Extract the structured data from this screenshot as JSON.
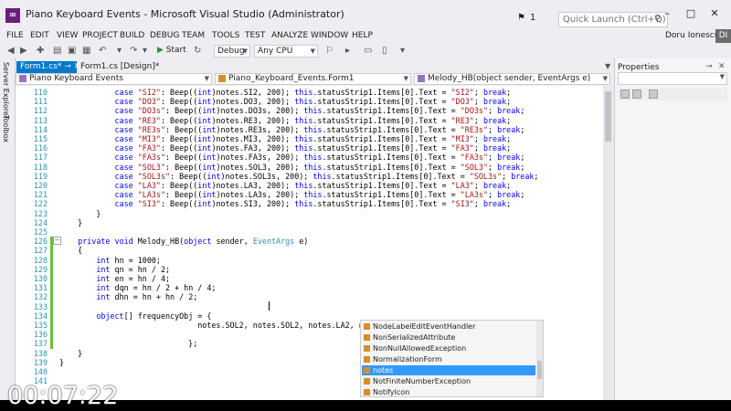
{
  "window": {
    "title": "Piano Keyboard Events - Microsoft Visual Studio (Administrator)",
    "notification_count": "1",
    "quick_launch_placeholder": "Quick Launch (Ctrl+Q)",
    "user": "Doru Ionescu",
    "user_initials": "DI"
  },
  "menu": [
    "FILE",
    "EDIT",
    "VIEW",
    "PROJECT",
    "BUILD",
    "DEBUG",
    "TEAM",
    "TOOLS",
    "TEST",
    "ANALYZE",
    "WINDOW",
    "HELP"
  ],
  "toolbar": {
    "start_label": "Start",
    "config": "Debug",
    "platform": "Any CPU"
  },
  "side_panels": [
    "Server Explorer",
    "Toolbox"
  ],
  "tabs": [
    {
      "label": "Form1.cs*",
      "active": true
    },
    {
      "label": "Form1.cs [Design]*",
      "active": false
    }
  ],
  "navigation": {
    "project": "Piano Keyboard Events",
    "class": "Piano_Keyboard_Events.Form1",
    "member": "Melody_HB(object sender, EventArgs e)"
  },
  "code": {
    "line_numbers": [
      "110",
      "111",
      "112",
      "113",
      "114",
      "115",
      "116",
      "117",
      "118",
      "119",
      "120",
      "121",
      "122",
      "123",
      "124",
      "125",
      "126",
      "127",
      "128",
      "129",
      "130",
      "131",
      "132",
      "133",
      "134",
      "135",
      "136",
      "137",
      "138",
      "139",
      "140",
      "141"
    ],
    "lines": [
      "            case \"SI2\": Beep((int)notes.SI2, 200); this.statusStrip1.Items[0].Text = \"SI2\"; break;",
      "            case \"DO3\": Beep((int)notes.DO3, 200); this.statusStrip1.Items[0].Text = \"DO3\"; break;",
      "            case \"DO3s\": Beep((int)notes.DO3s, 200); this.statusStrip1.Items[0].Text = \"DO3s\"; break;",
      "            case \"RE3\": Beep((int)notes.RE3, 200); this.statusStrip1.Items[0].Text = \"RE3\"; break;",
      "            case \"RE3s\": Beep((int)notes.RE3s, 200); this.statusStrip1.Items[0].Text = \"RE3s\"; break;",
      "            case \"MI3\": Beep((int)notes.MI3, 200); this.statusStrip1.Items[0].Text = \"MI3\"; break;",
      "            case \"FA3\": Beep((int)notes.FA3, 200); this.statusStrip1.Items[0].Text = \"FA3\"; break;",
      "            case \"FA3s\": Beep((int)notes.FA3s, 200); this.statusStrip1.Items[0].Text = \"FA3s\"; break;",
      "            case \"SOL3\": Beep((int)notes.SOL3, 200); this.statusStrip1.Items[0].Text = \"SOL3\"; break;",
      "            case \"SOL3s\": Beep((int)notes.SOL3s, 200); this.statusStrip1.Items[0].Text = \"SOL3s\"; break;",
      "            case \"LA3\": Beep((int)notes.LA3, 200); this.statusStrip1.Items[0].Text = \"LA3\"; break;",
      "            case \"LA3s\": Beep((int)notes.LA3s, 200); this.statusStrip1.Items[0].Text = \"LA3s\"; break;",
      "            case \"SI3\": Beep((int)notes.SI3, 200); this.statusStrip1.Items[0].Text = \"SI3\"; break;",
      "        }",
      "    }",
      "",
      "    private void Melody_HB(object sender, EventArgs e)",
      "    {",
      "        int hn = 1000;",
      "        int qn = hn / 2;",
      "        int en = hn / 4;",
      "        int dqn = hn / 2 + hn / 4;",
      "        int dhn = hn + hn / 2;",
      "",
      "        object[] frequencyObj = {",
      "                              notes.SOL2, notes.SOL2, notes.LA2, not",
      "",
      "                            };",
      "    }",
      "}",
      "",
      ""
    ]
  },
  "properties": {
    "title": "Properties"
  },
  "intellisense": {
    "items": [
      "NodeLabelEditEventHandler",
      "NonSerializedAttribute",
      "NonNullAllowedException",
      "NormalizationForm",
      "notes",
      "NotFiniteNumberException",
      "NotifyIcon"
    ],
    "selected_index": 4
  },
  "video_timer": "00:07:22",
  "colors": {
    "accent": "#007acc",
    "selection": "#3399ff",
    "keyword": "#0000ff",
    "string": "#a31515",
    "type": "#2b91af",
    "change_marker": "#6bbb3a"
  }
}
